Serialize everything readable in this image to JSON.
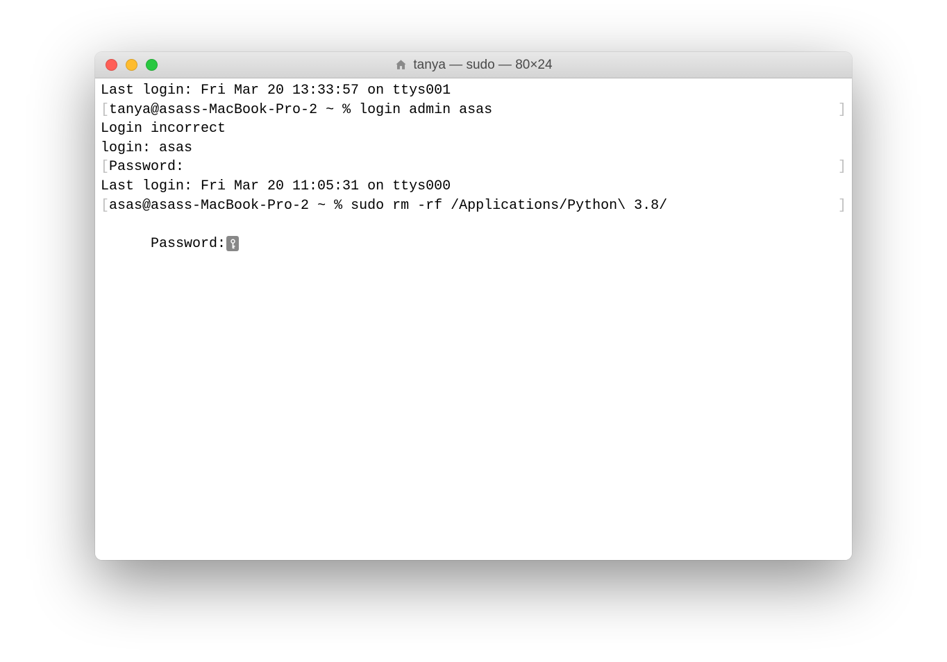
{
  "window": {
    "title": "tanya — sudo — 80×24"
  },
  "terminal": {
    "lines": [
      {
        "type": "plain",
        "text": "Last login: Fri Mar 20 13:33:57 on ttys001"
      },
      {
        "type": "bracketed",
        "text": "tanya@asass-MacBook-Pro-2 ~ % login admin asas"
      },
      {
        "type": "plain",
        "text": "Login incorrect"
      },
      {
        "type": "plain",
        "text": "login: asas"
      },
      {
        "type": "bracketed",
        "text": "Password:"
      },
      {
        "type": "plain",
        "text": "Last login: Fri Mar 20 11:05:31 on ttys000"
      },
      {
        "type": "bracketed",
        "text": "asas@asass-MacBook-Pro-2 ~ % sudo rm -rf /Applications/Python\\ 3.8/"
      },
      {
        "type": "password",
        "text": "Password:"
      }
    ]
  }
}
